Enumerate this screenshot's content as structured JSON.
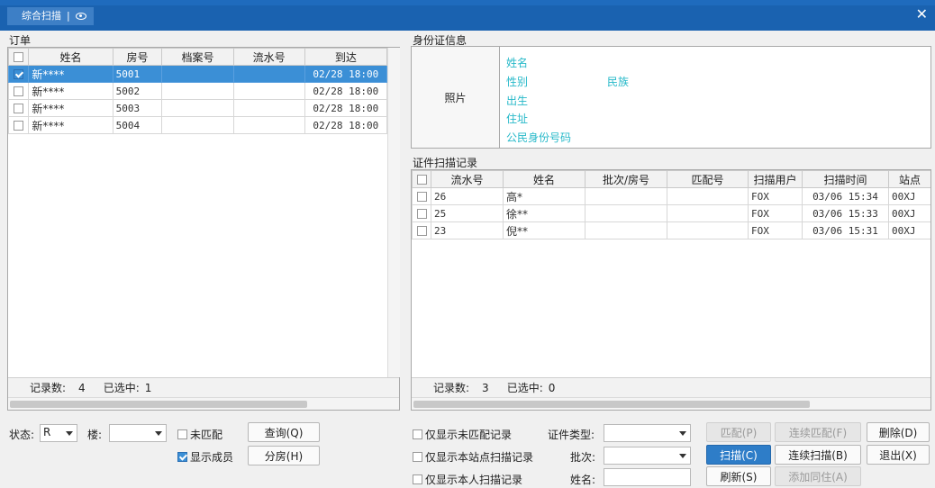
{
  "window": {
    "tab_title": "综合扫描",
    "tab_separator": "|"
  },
  "orders": {
    "section_title": "订单",
    "columns": [
      "姓名",
      "房号",
      "档案号",
      "流水号",
      "到达"
    ],
    "rows": [
      {
        "checked": true,
        "selected": true,
        "name": "新****",
        "room": "5001",
        "file_no": "",
        "serial": "",
        "arrival": "02/28 18:00"
      },
      {
        "checked": false,
        "selected": false,
        "name": "新****",
        "room": "5002",
        "file_no": "",
        "serial": "",
        "arrival": "02/28 18:00"
      },
      {
        "checked": false,
        "selected": false,
        "name": "新****",
        "room": "5003",
        "file_no": "",
        "serial": "",
        "arrival": "02/28 18:00"
      },
      {
        "checked": false,
        "selected": false,
        "name": "新****",
        "room": "5004",
        "file_no": "",
        "serial": "",
        "arrival": "02/28 18:00"
      }
    ],
    "footer": {
      "count_label": "记录数:",
      "count_value": "4",
      "selected_label": "已选中:",
      "selected_value": "1"
    }
  },
  "id_card": {
    "section_title": "身份证信息",
    "photo_label": "照片",
    "fields": {
      "name": "姓名",
      "gender": "性别",
      "ethnicity": "民族",
      "birth": "出生",
      "address": "住址",
      "id_number": "公民身份号码"
    }
  },
  "scan_records": {
    "section_title": "证件扫描记录",
    "columns": [
      "流水号",
      "姓名",
      "批次/房号",
      "匹配号",
      "扫描用户",
      "扫描时间",
      "站点"
    ],
    "rows": [
      {
        "serial": "26",
        "name": "高*",
        "batch_room": "",
        "match_no": "",
        "user": "FOX",
        "time": "03/06 15:34",
        "site": "00XJ"
      },
      {
        "serial": "25",
        "name": "徐**",
        "batch_room": "",
        "match_no": "",
        "user": "FOX",
        "time": "03/06 15:33",
        "site": "00XJ"
      },
      {
        "serial": "23",
        "name": "倪**",
        "batch_room": "",
        "match_no": "",
        "user": "FOX",
        "time": "03/06 15:31",
        "site": "00XJ"
      }
    ],
    "footer": {
      "count_label": "记录数:",
      "count_value": "3",
      "selected_label": "已选中:",
      "selected_value": "0"
    }
  },
  "left_controls": {
    "status_label": "状态:",
    "status_value": "R",
    "building_label": "楼:",
    "building_value": "",
    "unmatched_label": "未匹配",
    "unmatched_checked": false,
    "show_members_label": "显示成员",
    "show_members_checked": true,
    "query_button": "查询(Q)",
    "assign_room_button": "分房(H)"
  },
  "right_controls": {
    "only_unmatched_label": "仅显示未匹配记录",
    "only_site_label": "仅显示本站点扫描记录",
    "only_mine_label": "仅显示本人扫描记录",
    "cert_type_label": "证件类型:",
    "cert_type_value": "",
    "batch_label": "批次:",
    "batch_value": "",
    "name_label": "姓名:",
    "name_value": "",
    "buttons": {
      "match": "匹配(P)",
      "continuous_match": "连续匹配(F)",
      "delete": "删除(D)",
      "scan": "扫描(C)",
      "continuous_scan": "连续扫描(B)",
      "exit": "退出(X)",
      "refresh": "刷新(S)",
      "add_companion": "添加同住(A)"
    }
  },
  "colors": {
    "title_bar": "#1a62b0",
    "selection": "#3b8fd6",
    "id_field_text": "#27b9c9",
    "primary_button": "#2e7dc8"
  }
}
